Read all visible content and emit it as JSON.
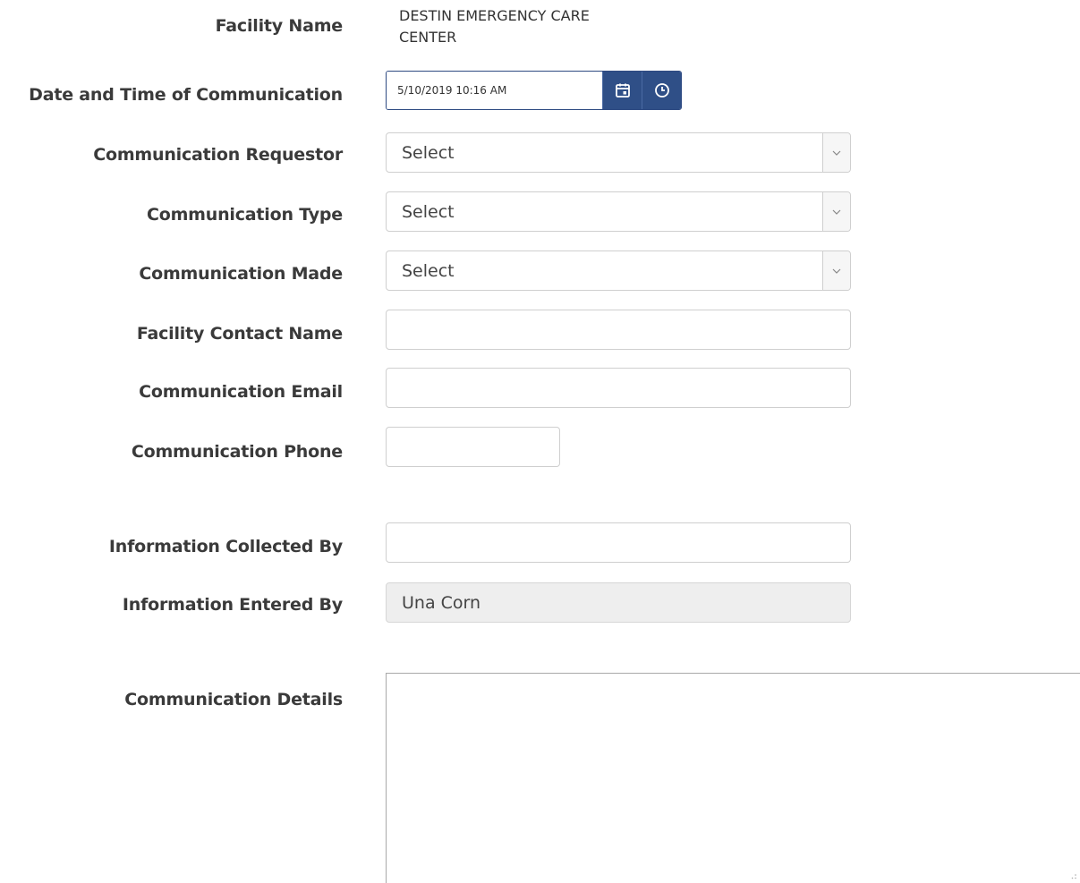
{
  "labels": {
    "facility_name": "Facility Name",
    "date_time": "Date and Time of Communication",
    "requestor": "Communication Requestor",
    "type": "Communication Type",
    "made": "Communication Made",
    "contact_name": "Facility Contact Name",
    "email": "Communication Email",
    "phone": "Communication Phone",
    "collected_by": "Information Collected By",
    "entered_by": "Information Entered By",
    "details": "Communication Details"
  },
  "facility_name": {
    "line1": "DESTIN EMERGENCY CARE",
    "line2": "CENTER"
  },
  "datetime": {
    "value": "5/10/2019 10:16 AM"
  },
  "selects": {
    "requestor": "Select",
    "type": "Select",
    "made": "Select"
  },
  "fields": {
    "contact_name": "",
    "email": "",
    "phone": "",
    "collected_by": "",
    "entered_by": "Una Corn",
    "details": ""
  },
  "icons": {
    "calendar": "calendar-icon",
    "clock": "clock-icon",
    "chevron": "chevron-down-icon"
  },
  "colors": {
    "accent": "#2f4f87",
    "border": "#cfcfcf",
    "readonly_bg": "#eeeeee"
  }
}
